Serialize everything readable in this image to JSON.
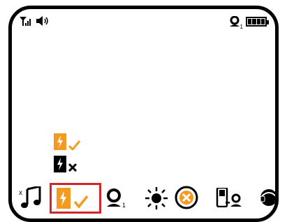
{
  "screen": {
    "status_bar": {
      "icons_left": [
        "signal-icon",
        "speaker-icon"
      ],
      "icons_right": [
        "bluetooth-icon",
        "battery-icon"
      ],
      "right_subscript": "1"
    },
    "menu_list": [
      {
        "icon": "charging-icon",
        "status": "check"
      },
      {
        "icon": "charging-icon",
        "status": "cross"
      }
    ],
    "bottom_bar": {
      "icons": [
        "ringtone-icon",
        "charging-check-icon",
        "bluetooth-device-icon",
        "brightness-icon",
        "cancel-circle-icon",
        "phone-connect-icon",
        "headset-icon"
      ],
      "bt_subscript": "1",
      "selected": "charging-check-icon"
    },
    "colors": {
      "accent": "#f39a1f",
      "highlight": "#d6252a",
      "ink": "#000000"
    }
  }
}
